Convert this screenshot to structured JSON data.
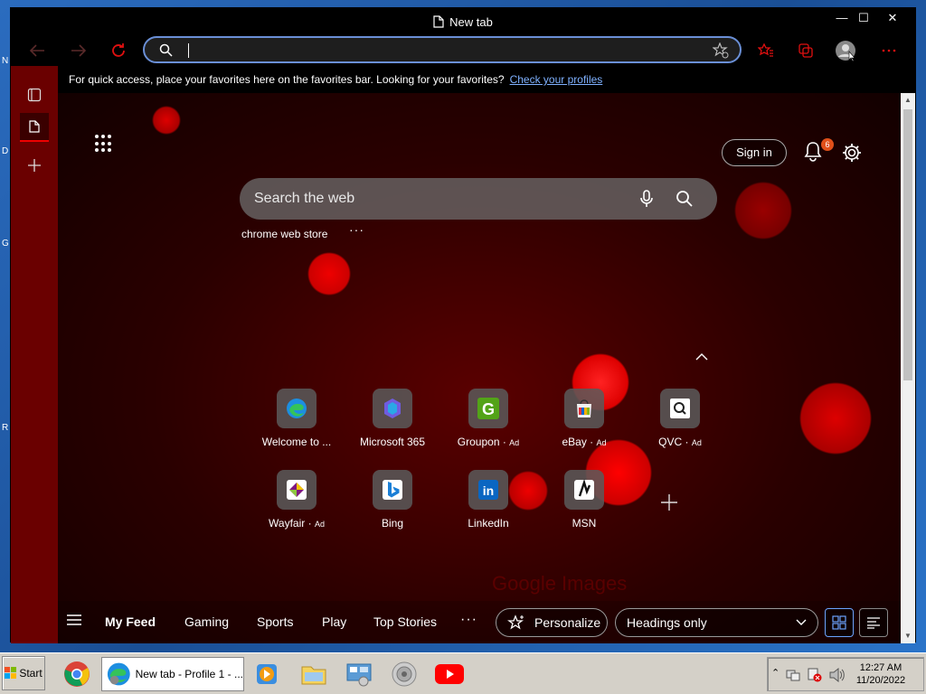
{
  "window": {
    "title": "New tab",
    "controls": {
      "minimize": "—",
      "maximize": "☐",
      "close": "✕"
    }
  },
  "address_bar": {
    "value": "",
    "placeholder": ""
  },
  "favorites_bar": {
    "message": "For quick access, place your favorites here on the favorites bar. Looking for your favorites?",
    "link": "Check your profiles"
  },
  "newtab": {
    "sign_in": "Sign in",
    "notification_count": "6",
    "search_placeholder": "Search the web",
    "suggestion": "chrome web store",
    "more": "···",
    "tiles_row1": [
      {
        "label": "Welcome to ...",
        "ad": "",
        "icon": "edge-icon"
      },
      {
        "label": "Microsoft 365",
        "ad": "",
        "icon": "microsoft-365-icon"
      },
      {
        "label": "Groupon",
        "ad": "Ad",
        "icon": "groupon-icon"
      },
      {
        "label": "eBay",
        "ad": "Ad",
        "icon": "ebay-icon"
      },
      {
        "label": "QVC",
        "ad": "Ad",
        "icon": "qvc-icon"
      }
    ],
    "tiles_row2": [
      {
        "label": "Wayfair",
        "ad": "Ad",
        "icon": "wayfair-icon"
      },
      {
        "label": "Bing",
        "ad": "",
        "icon": "bing-icon"
      },
      {
        "label": "LinkedIn",
        "ad": "",
        "icon": "linkedin-icon"
      },
      {
        "label": "MSN",
        "ad": "",
        "icon": "msn-icon"
      }
    ],
    "watermark": "Google Images"
  },
  "feed": {
    "tabs": [
      "My Feed",
      "Gaming",
      "Sports",
      "Play",
      "Top Stories"
    ],
    "more": "···",
    "personalize": "Personalize",
    "layout_select": "Headings only"
  },
  "taskbar": {
    "start": "Start",
    "task_item": "New tab - Profile 1 - ...",
    "time": "12:27 AM",
    "date": "11/20/2022"
  },
  "colors": {
    "accent": "#6a8fd6",
    "sidebar": "#6a0000",
    "badge": "#e0501a"
  }
}
